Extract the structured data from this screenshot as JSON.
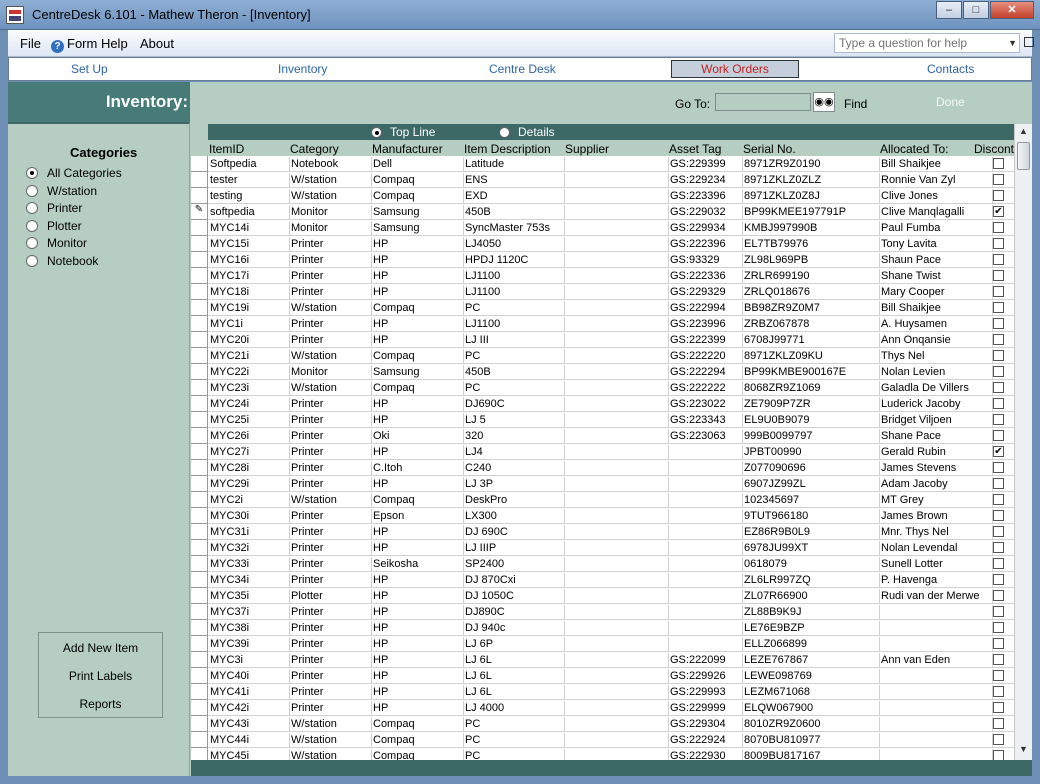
{
  "window": {
    "title": "CentreDesk 6.101 - Mathew Theron - [Inventory]"
  },
  "menu": {
    "file": "File",
    "form_help": "Form Help",
    "about": "About",
    "ask_placeholder": "Type a question for help"
  },
  "nav": {
    "tabs": [
      "Set Up",
      "Inventory",
      "Centre Desk",
      "Work Orders",
      "Contacts"
    ],
    "active": "Work Orders"
  },
  "header": {
    "title": "Inventory:",
    "goto_label": "Go To:",
    "find_label": "Find",
    "done_label": "Done"
  },
  "sidebar": {
    "title": "Categories",
    "options": [
      "All Categories",
      "W/station",
      "Printer",
      "Plotter",
      "Monitor",
      "Notebook"
    ],
    "selected": "All Categories",
    "actions": [
      "Add New Item",
      "Print Labels",
      "Reports"
    ]
  },
  "view": {
    "top_line": "Top Line",
    "details": "Details",
    "selected": "Top Line"
  },
  "columns": [
    "ItemID",
    "Category",
    "Manufacturer",
    "Item Description",
    "Supplier",
    "Asset Tag",
    "Serial No.",
    "Allocated To:",
    "Discont"
  ],
  "rows": [
    [
      "Softpedia",
      "Notebook",
      "Dell",
      "Latitude",
      "",
      "GS:229399",
      "8971ZR9Z0190",
      "Bill Shaikjee",
      false
    ],
    [
      "tester",
      "W/station",
      "Compaq",
      "ENS",
      "",
      "GS:229234",
      "8971ZKLZ0ZLZ",
      "Ronnie Van Zyl",
      false
    ],
    [
      "testing",
      "W/station",
      "Compaq",
      "EXD",
      "",
      "GS:223396",
      "8971ZKLZ0Z8J",
      "Clive Jones",
      false
    ],
    [
      "softpedia",
      "Monitor",
      "Samsung",
      "450B",
      "",
      "GS:229032",
      "BP99KMEE197791P",
      "Clive Manqlagalli",
      true
    ],
    [
      "MYC14i",
      "Monitor",
      "Samsung",
      "SyncMaster 753s",
      "",
      "GS:229934",
      "KMBJ997990B",
      "Paul Fumba",
      false
    ],
    [
      "MYC15i",
      "Printer",
      "HP",
      "LJ4050",
      "",
      "GS:222396",
      "EL7TB79976",
      "Tony Lavita",
      false
    ],
    [
      "MYC16i",
      "Printer",
      "HP",
      "HPDJ 1120C",
      "",
      "GS:93329",
      "ZL98L969PB",
      "Shaun Pace",
      false
    ],
    [
      "MYC17i",
      "Printer",
      "HP",
      "LJ1100",
      "",
      "GS:222336",
      "ZRLR699190",
      "Shane Twist",
      false
    ],
    [
      "MYC18i",
      "Printer",
      "HP",
      "LJ1100",
      "",
      "GS:229329",
      "ZRLQ018676",
      "Mary Cooper",
      false
    ],
    [
      "MYC19i",
      "W/station",
      "Compaq",
      "PC",
      "",
      "GS:222994",
      "BB98ZR9Z0M7",
      "Bill Shaikjee",
      false
    ],
    [
      "MYC1i",
      "Printer",
      "HP",
      "LJ1100",
      "",
      "GS:223996",
      "ZRBZ067878",
      "A. Huysamen",
      false
    ],
    [
      "MYC20i",
      "Printer",
      "HP",
      "LJ III",
      "",
      "GS:222399",
      "6708J99771",
      "Ann Onqansie",
      false
    ],
    [
      "MYC21i",
      "W/station",
      "Compaq",
      "PC",
      "",
      "GS:222220",
      "8971ZKLZ09KU",
      "Thys Nel",
      false
    ],
    [
      "MYC22i",
      "Monitor",
      "Samsung",
      "450B",
      "",
      "GS:222294",
      "BP99KMBE900167E",
      "Nolan Levien",
      false
    ],
    [
      "MYC23i",
      "W/station",
      "Compaq",
      "PC",
      "",
      "GS:222222",
      "8068ZR9Z1069",
      "Galadla De Villers",
      false
    ],
    [
      "MYC24i",
      "Printer",
      "HP",
      "DJ690C",
      "",
      "GS:223022",
      "ZE7909P7ZR",
      "Luderick Jacoby",
      false
    ],
    [
      "MYC25i",
      "Printer",
      "HP",
      "LJ 5",
      "",
      "GS:223343",
      "EL9U0B9079",
      "Bridget Viljoen",
      false
    ],
    [
      "MYC26i",
      "Printer",
      "Oki",
      "320",
      "",
      "GS:223063",
      "999B0099797",
      "Shane Pace",
      false
    ],
    [
      "MYC27i",
      "Printer",
      "HP",
      "LJ4",
      "",
      "",
      "JPBT00990",
      "Gerald Rubin",
      true
    ],
    [
      "MYC28i",
      "Printer",
      "C.Itoh",
      "C240",
      "",
      "",
      "Z077090696",
      "James Stevens",
      false
    ],
    [
      "MYC29i",
      "Printer",
      "HP",
      "LJ 3P",
      "",
      "",
      "6907JZ99ZL",
      "Adam Jacoby",
      false
    ],
    [
      "MYC2i",
      "W/station",
      "Compaq",
      "DeskPro",
      "",
      "",
      "102345697",
      "MT Grey",
      false
    ],
    [
      "MYC30i",
      "Printer",
      "Epson",
      "LX300",
      "",
      "",
      "9TUT966180",
      "James Brown",
      false
    ],
    [
      "MYC31i",
      "Printer",
      "HP",
      "DJ 690C",
      "",
      "",
      "EZ86R9B0L9",
      "Mnr. Thys Nel",
      false
    ],
    [
      "MYC32i",
      "Printer",
      "HP",
      "LJ IIIP",
      "",
      "",
      "6978JU99XT",
      "Nolan Levendal",
      false
    ],
    [
      "MYC33i",
      "Printer",
      "Seikosha",
      "SP2400",
      "",
      "",
      "0618079",
      "Sunell Lotter",
      false
    ],
    [
      "MYC34i",
      "Printer",
      "HP",
      "DJ 870Cxi",
      "",
      "",
      "ZL6LR997ZQ",
      "P. Havenga",
      false
    ],
    [
      "MYC35i",
      "Plotter",
      "HP",
      "DJ 1050C",
      "",
      "",
      "ZL07R66900",
      "Rudi van der Merwe",
      false
    ],
    [
      "MYC37i",
      "Printer",
      "HP",
      "DJ890C",
      "",
      "",
      "ZL88B9K9J",
      "",
      false
    ],
    [
      "MYC38i",
      "Printer",
      "HP",
      "DJ 940c",
      "",
      "",
      "LE76E9BZP",
      "",
      false
    ],
    [
      "MYC39i",
      "Printer",
      "HP",
      "LJ 6P",
      "",
      "",
      "ELLZ066899",
      "",
      false
    ],
    [
      "MYC3i",
      "Printer",
      "HP",
      "LJ 6L",
      "",
      "GS:222099",
      "LEZE767867",
      "Ann van Eden",
      false
    ],
    [
      "MYC40i",
      "Printer",
      "HP",
      "LJ 6L",
      "",
      "GS:229926",
      "LEWE098769",
      "",
      false
    ],
    [
      "MYC41i",
      "Printer",
      "HP",
      "LJ 6L",
      "",
      "GS:229993",
      "LEZM671068",
      "",
      false
    ],
    [
      "MYC42i",
      "Printer",
      "HP",
      "LJ 4000",
      "",
      "GS:229999",
      "ELQW067900",
      "",
      false
    ],
    [
      "MYC43i",
      "W/station",
      "Compaq",
      "PC",
      "",
      "GS:229304",
      "8010ZR9Z0600",
      "",
      false
    ],
    [
      "MYC44i",
      "W/station",
      "Compaq",
      "PC",
      "",
      "GS:222924",
      "8070BU810977",
      "",
      false
    ],
    [
      "MYC45i",
      "W/station",
      "Compaq",
      "PC",
      "",
      "GS:222930",
      "8009BU817167",
      "",
      false
    ]
  ]
}
